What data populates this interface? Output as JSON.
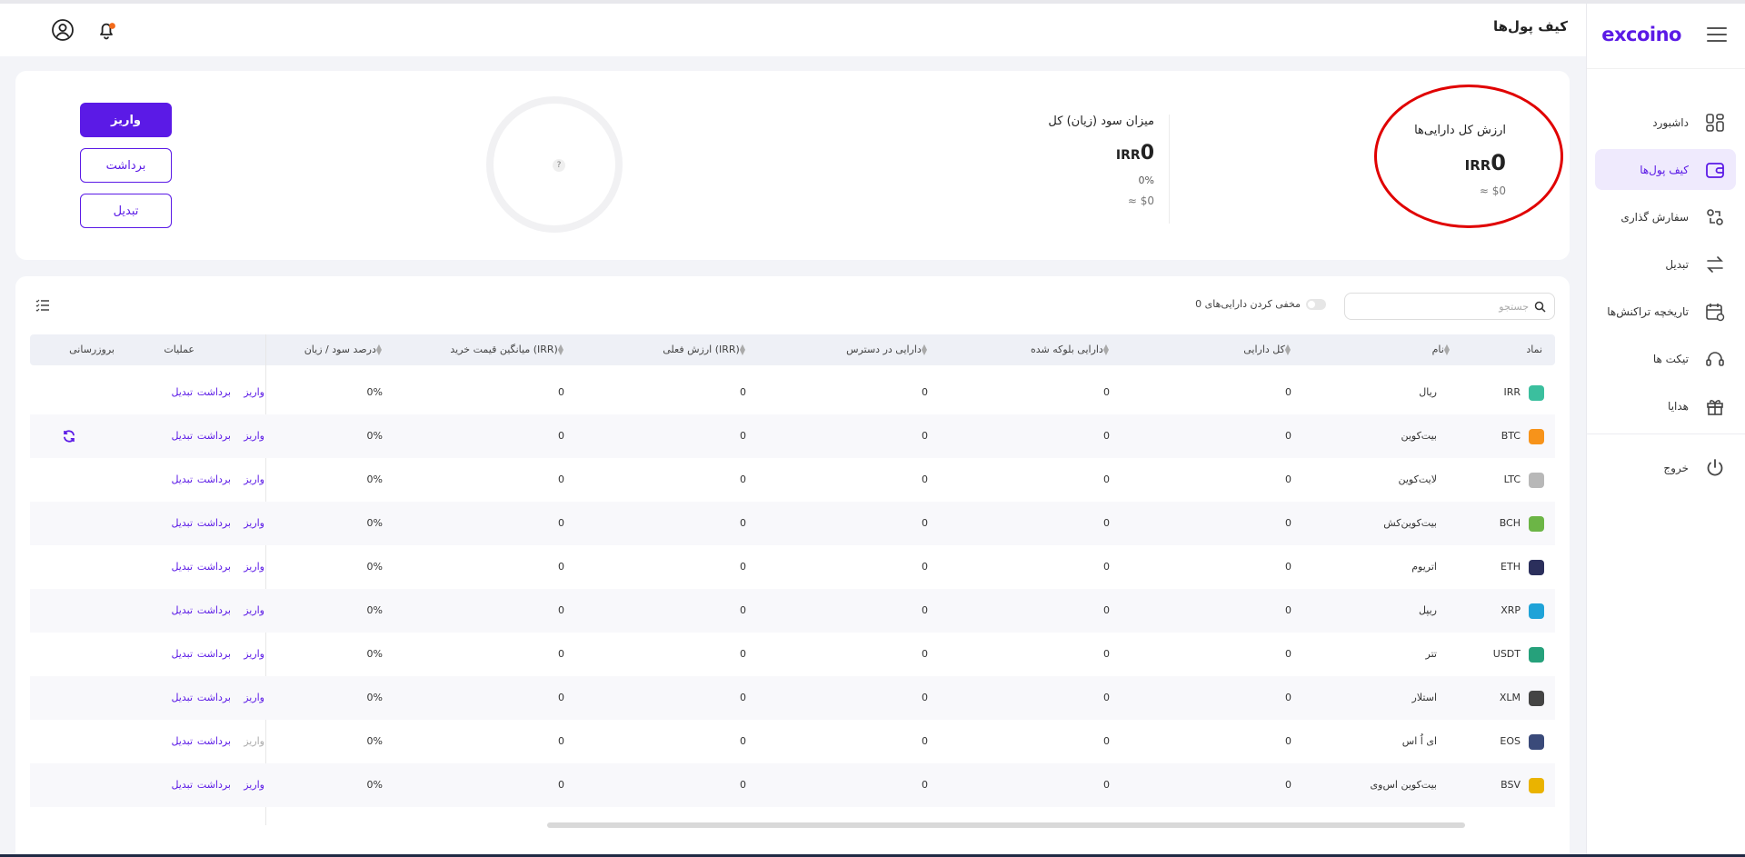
{
  "app": {
    "logo": "excoino",
    "page_title": "کیف پول‌ها"
  },
  "sidebar": {
    "items": [
      {
        "label": "داشبورد",
        "icon": "dashboard-icon",
        "active": false
      },
      {
        "label": "کیف پول‌ها",
        "icon": "wallet-icon",
        "active": true
      },
      {
        "label": "سفارش گذاری",
        "icon": "order-icon",
        "active": false
      },
      {
        "label": "تبدیل",
        "icon": "swap-icon",
        "active": false
      },
      {
        "label": "تاریخچه تراکنش‌ها",
        "icon": "history-icon",
        "active": false
      },
      {
        "label": "تیکت ها",
        "icon": "headset-icon",
        "active": false
      },
      {
        "label": "هدایا",
        "icon": "gift-icon",
        "active": false
      }
    ],
    "logout": {
      "label": "خروج",
      "icon": "power-icon"
    }
  },
  "summary": {
    "total": {
      "label": "ارزش کل دارایی‌ها",
      "amount": "0",
      "currency": "IRR",
      "usd": "≈ $0"
    },
    "profit": {
      "label": "میزان سود (زیان) کل",
      "amount": "0",
      "currency": "IRR",
      "percent": "0%",
      "usd": "≈ $0"
    },
    "chart_placeholder": "?",
    "buttons": {
      "deposit": "واریز",
      "withdraw": "برداشت",
      "convert": "تبدیل"
    }
  },
  "table": {
    "search_placeholder": "جستجو",
    "hide_label": "مخفی کردن دارایی‌های 0",
    "headers": {
      "symbol": "نماد",
      "name": "نام",
      "total": "کل دارایی",
      "blocked": "دارایی بلوکه شده",
      "available": "دارایی در دسترس",
      "value": "ارزش فعلی (IRR)",
      "avg_price": "میانگین قیمت خرید (IRR)",
      "pnl": "درصد سود / زیان",
      "ops": "عملیات",
      "update": "بروزرسانی"
    },
    "actions": {
      "deposit": "واریز",
      "withdraw": "برداشت",
      "convert": "تبدیل"
    },
    "rows": [
      {
        "symbol": "IRR",
        "name": "ریال",
        "total": "0",
        "blocked": "0",
        "available": "0",
        "value": "0",
        "avg": "0",
        "pnl": "0%",
        "color": "#3bbf9e",
        "deposit_enabled": true,
        "refresh": false
      },
      {
        "symbol": "BTC",
        "name": "بیت‌کوین",
        "total": "0",
        "blocked": "0",
        "available": "0",
        "value": "0",
        "avg": "0",
        "pnl": "0%",
        "color": "#f7931a",
        "deposit_enabled": true,
        "refresh": true
      },
      {
        "symbol": "LTC",
        "name": "لایت‌کوین",
        "total": "0",
        "blocked": "0",
        "available": "0",
        "value": "0",
        "avg": "0",
        "pnl": "0%",
        "color": "#b8b8b8",
        "deposit_enabled": true,
        "refresh": false
      },
      {
        "symbol": "BCH",
        "name": "بیت‌کوین‌کش",
        "total": "0",
        "blocked": "0",
        "available": "0",
        "value": "0",
        "avg": "0",
        "pnl": "0%",
        "color": "#6cb546",
        "deposit_enabled": true,
        "refresh": false
      },
      {
        "symbol": "ETH",
        "name": "اتریوم",
        "total": "0",
        "blocked": "0",
        "available": "0",
        "value": "0",
        "avg": "0",
        "pnl": "0%",
        "color": "#2b2f5c",
        "deposit_enabled": true,
        "refresh": false
      },
      {
        "symbol": "XRP",
        "name": "ریپل",
        "total": "0",
        "blocked": "0",
        "available": "0",
        "value": "0",
        "avg": "0",
        "pnl": "0%",
        "color": "#1fa3d8",
        "deposit_enabled": true,
        "refresh": false
      },
      {
        "symbol": "USDT",
        "name": "تتر",
        "total": "0",
        "blocked": "0",
        "available": "0",
        "value": "0",
        "avg": "0",
        "pnl": "0%",
        "color": "#26a17b",
        "deposit_enabled": true,
        "refresh": false
      },
      {
        "symbol": "XLM",
        "name": "استلار",
        "total": "0",
        "blocked": "0",
        "available": "0",
        "value": "0",
        "avg": "0",
        "pnl": "0%",
        "color": "#444444",
        "deposit_enabled": true,
        "refresh": false
      },
      {
        "symbol": "EOS",
        "name": "ای اُ اس",
        "total": "0",
        "blocked": "0",
        "available": "0",
        "value": "0",
        "avg": "0",
        "pnl": "0%",
        "color": "#3a4a7a",
        "deposit_enabled": false,
        "refresh": false
      },
      {
        "symbol": "BSV",
        "name": "بیت‌کوین اس‌وی",
        "total": "0",
        "blocked": "0",
        "available": "0",
        "value": "0",
        "avg": "0",
        "pnl": "0%",
        "color": "#eab300",
        "deposit_enabled": true,
        "refresh": false
      }
    ]
  },
  "colors": {
    "accent": "#5b1ae6",
    "highlight": "#e00000"
  }
}
